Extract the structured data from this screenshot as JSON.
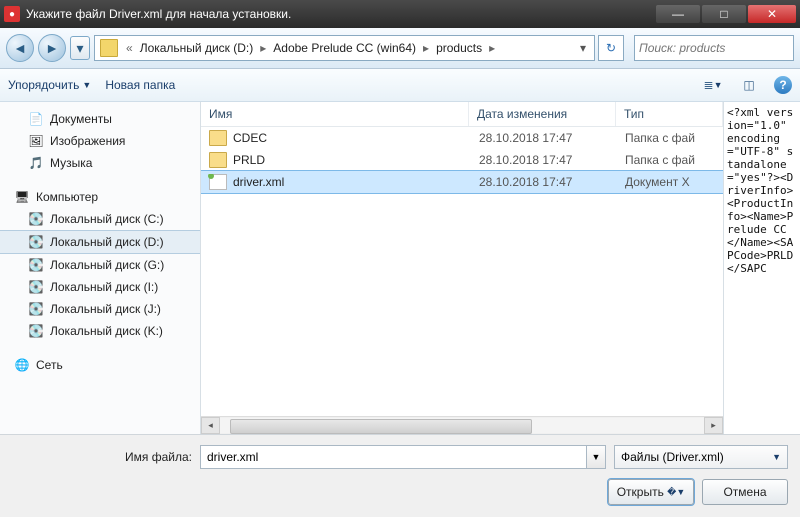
{
  "titlebar": {
    "title": "Укажите файл Driver.xml для начала установки."
  },
  "nav": {
    "breadcrumb": [
      "Локальный диск (D:)",
      "Adobe Prelude CC (win64)",
      "products"
    ],
    "search_placeholder": "Поиск: products"
  },
  "toolbar": {
    "organize": "Упорядочить",
    "new_folder": "Новая папка"
  },
  "sidebar": {
    "libs": [
      {
        "icon": "ico-lib",
        "label": "Документы"
      },
      {
        "icon": "ico-img",
        "label": "Изображения"
      },
      {
        "icon": "ico-mus",
        "label": "Музыка"
      }
    ],
    "computer": "Компьютер",
    "drives": [
      "Локальный диск (C:)",
      "Локальный диск (D:)",
      "Локальный диск (G:)",
      "Локальный диск (I:)",
      "Локальный диск (J:)",
      "Локальный диск (K:)"
    ],
    "network": "Сеть"
  },
  "columns": {
    "name": "Имя",
    "date": "Дата изменения",
    "type": "Тип"
  },
  "files": [
    {
      "icon": "folder",
      "name": "CDEC",
      "date": "28.10.2018 17:47",
      "type": "Папка с фай"
    },
    {
      "icon": "folder",
      "name": "PRLD",
      "date": "28.10.2018 17:47",
      "type": "Папка с фай"
    },
    {
      "icon": "xml",
      "name": "driver.xml",
      "date": "28.10.2018 17:47",
      "type": "Документ X",
      "selected": true
    }
  ],
  "preview": "<?xml version=\"1.0\" encoding=\"UTF-8\" standalone=\"yes\"?><DriverInfo><ProductInfo><Name>Prelude CC</Name><SAPCode>PRLD</SAPC",
  "footer": {
    "filename_label": "Имя файла:",
    "filename_value": "driver.xml",
    "filetype": "Файлы (Driver.xml)",
    "open": "Открыть",
    "cancel": "Отмена"
  }
}
